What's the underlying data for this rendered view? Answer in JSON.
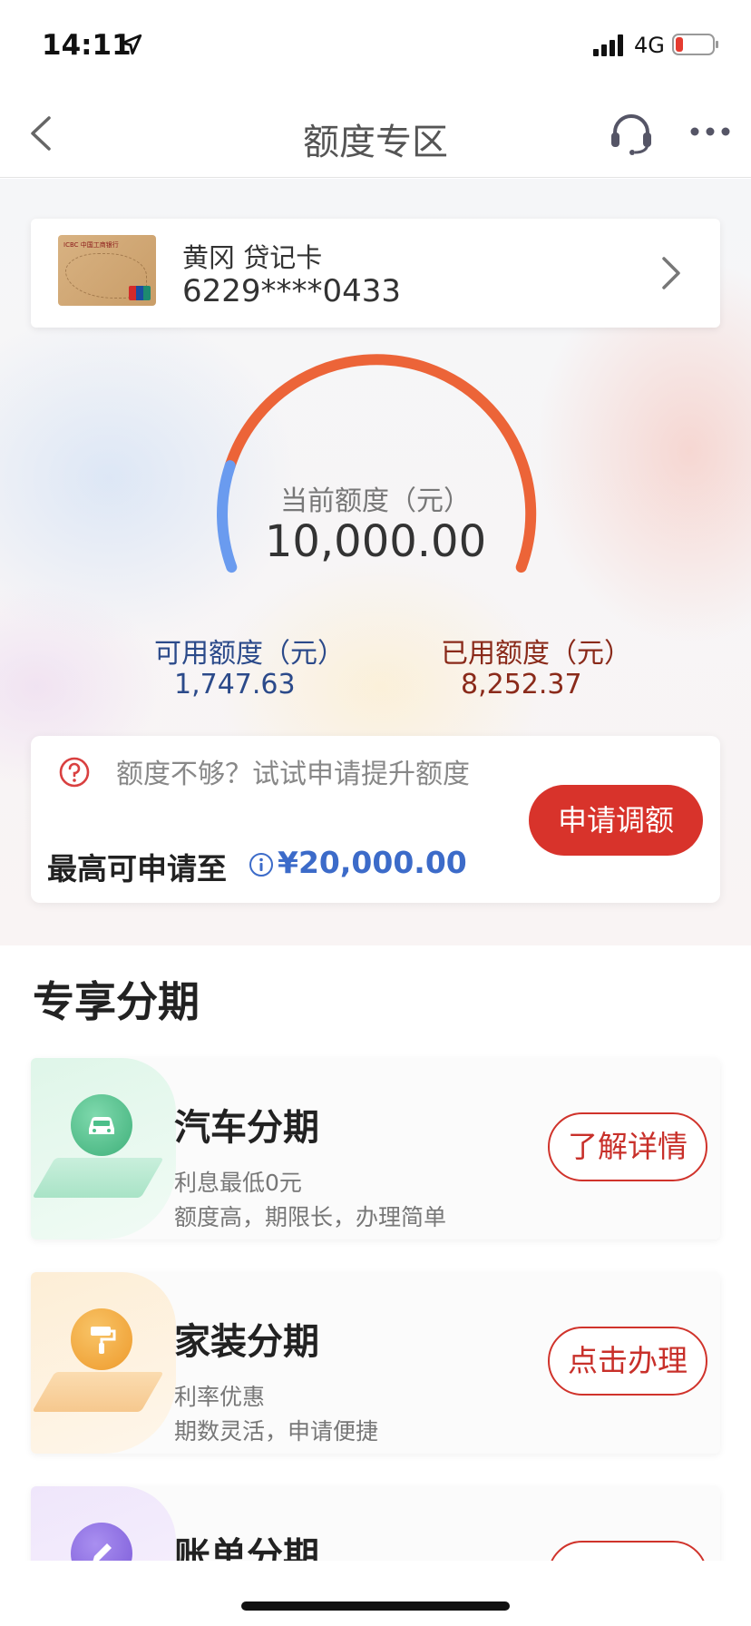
{
  "status_bar": {
    "time": "14:11",
    "network": "4G"
  },
  "nav": {
    "title": "额度专区"
  },
  "card": {
    "name": "黄冈 贷记卡",
    "number": "6229****0433",
    "bank_text": "ICBC 中国工商银行"
  },
  "limit": {
    "current_label": "当前额度（元）",
    "current_value": "10,000.00",
    "available_label": "可用额度（元）",
    "available_value": "1,747.63",
    "used_label": "已用额度（元）",
    "used_value": "8,252.37",
    "available_fraction": 0.1748,
    "colors": {
      "available": "#6a9bef",
      "used": "#ec6438"
    }
  },
  "apply": {
    "tip": "额度不够？试试申请提升额度",
    "max_label": "最高可申请至",
    "max_value": "¥20,000.00",
    "button": "申请调额"
  },
  "section": {
    "title": "专享分期"
  },
  "promos": [
    {
      "title": "汽车分期",
      "line1": "利息最低0元",
      "line2": "额度高，期限长，办理简单",
      "button": "了解详情",
      "icon": "car-icon",
      "color": "#4cbf8a"
    },
    {
      "title": "家装分期",
      "line1": "利率优惠",
      "line2": "期数灵活，申请便捷",
      "button": "点击办理",
      "icon": "paint-roller-icon",
      "color": "#f0a63a"
    },
    {
      "title": "账单分期",
      "line1": "",
      "line2": "",
      "button": "",
      "icon": "pencil-icon",
      "color": "#8a6ae0"
    }
  ]
}
